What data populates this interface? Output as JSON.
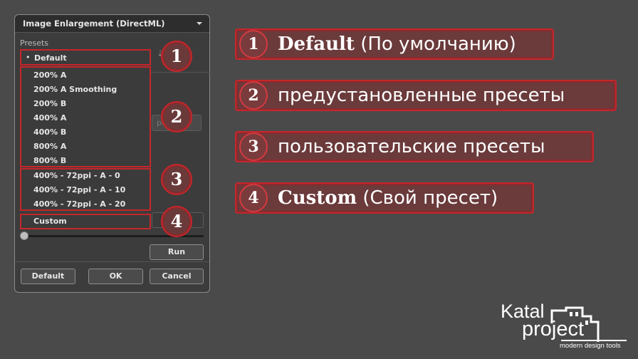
{
  "dialog": {
    "title": "Image Enlargement (DirectML)",
    "presets_label": "Presets",
    "ghost_button_text": "pe...",
    "buttons": {
      "run": "Run",
      "default": "Default",
      "ok": "OK",
      "cancel": "Cancel"
    }
  },
  "dropdown": {
    "selected_bullet": "•",
    "default_item": "Default",
    "builtin": [
      "200% A",
      "200% A Smoothing",
      "200% B",
      "400% A",
      "400% B",
      "800% A",
      "800% B"
    ],
    "user": [
      "400% - 72ppi - A - 0",
      "400% - 72ppi - A - 10",
      "400% - 72ppi - A - 20"
    ],
    "custom": "Custom"
  },
  "markers": [
    "1",
    "2",
    "3",
    "4"
  ],
  "callouts": [
    {
      "num": "1",
      "bold": "Default",
      "text": "(По умолчанию)"
    },
    {
      "num": "2",
      "bold": "",
      "text": "предустановленные пресеты"
    },
    {
      "num": "3",
      "bold": "",
      "text": "пользовательские пресеты"
    },
    {
      "num": "4",
      "bold": "Custom",
      "text": "(Свой пресет)"
    }
  ],
  "logo": {
    "line1": "Katal",
    "line2": "project",
    "tagline": "modern design tools"
  },
  "colors": {
    "accent": "#c6262b",
    "background": "#4a4a4a",
    "panel": "#3c3c3c"
  }
}
